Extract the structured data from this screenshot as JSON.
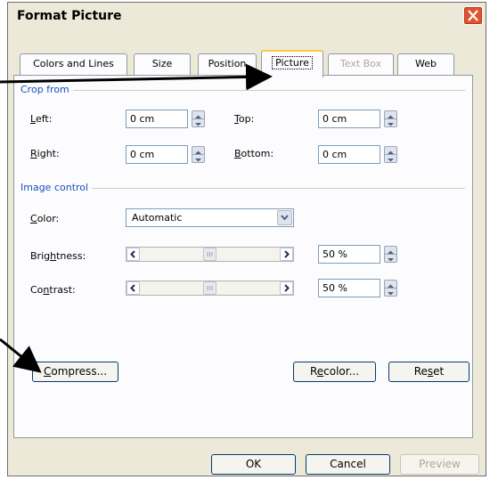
{
  "window": {
    "title": "Format Picture"
  },
  "tabs": [
    {
      "label": "Colors and Lines",
      "state": "normal"
    },
    {
      "label": "Size",
      "state": "normal"
    },
    {
      "label": "Position",
      "state": "normal"
    },
    {
      "label": "Picture",
      "state": "active"
    },
    {
      "label": "Text Box",
      "state": "disabled"
    },
    {
      "label": "Web",
      "state": "normal"
    }
  ],
  "crop": {
    "group_label": "Crop from",
    "left": {
      "label_u": "L",
      "label_rest": "eft:",
      "value": "0 cm"
    },
    "top": {
      "label_u": "T",
      "label_rest": "op:",
      "value": "0 cm"
    },
    "right": {
      "label_u": "R",
      "label_rest": "ight:",
      "value": "0 cm"
    },
    "bottom": {
      "label_u": "B",
      "label_rest": "ottom:",
      "value": "0 cm"
    }
  },
  "image_control": {
    "group_label": "Image control",
    "color": {
      "label_u": "C",
      "label_rest": "olor:",
      "value": "Automatic"
    },
    "brightness": {
      "label_pre": "Brig",
      "label_u": "h",
      "label_rest": "tness:",
      "value": "50 %",
      "level_percent": 50
    },
    "contrast": {
      "label_pre": "Co",
      "label_u": "n",
      "label_rest": "trast:",
      "value": "50 %",
      "level_percent": 50
    }
  },
  "buttons": {
    "compress": {
      "label_u": "C",
      "label_rest": "ompress..."
    },
    "recolor": {
      "label_pre": "R",
      "label_u": "e",
      "label_rest": "color..."
    },
    "reset": {
      "label_pre": "Re",
      "label_u": "s",
      "label_rest": "et"
    },
    "ok": "OK",
    "cancel": "Cancel",
    "preview": "Preview"
  },
  "colors": {
    "accent_tab": "#ffc83c",
    "close_button": "#e2522f",
    "group_label": "#1a4fb8"
  },
  "icons": [
    "close-icon",
    "spin-up-icon",
    "spin-down-icon",
    "dropdown-arrow-icon",
    "scroll-left-icon",
    "scroll-right-icon",
    "slider-thumb-icon",
    "annotation-arrow-icon"
  ]
}
